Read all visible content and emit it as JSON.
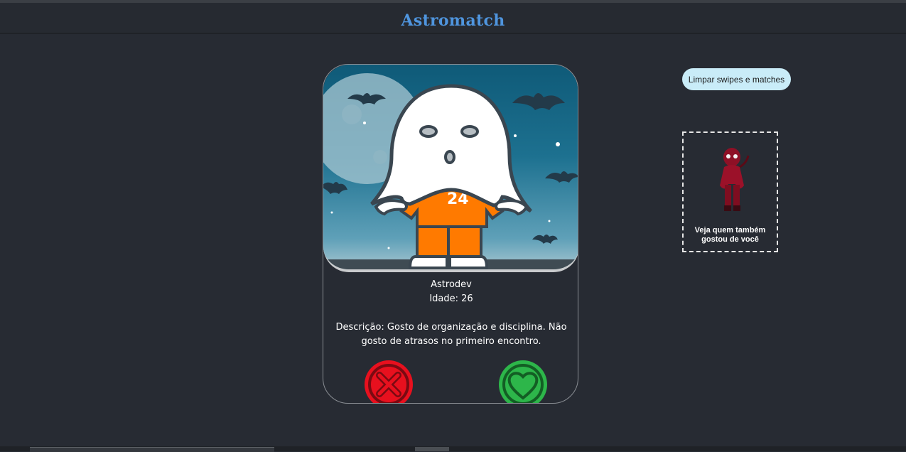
{
  "header": {
    "title": "Astromatch"
  },
  "profile": {
    "name": "Astrodev",
    "age_text": "Idade: 26",
    "description": "Descrição: Gosto de organização e disciplina. Não gosto de atrasos no primeiro encontro.",
    "shirt_number": "24"
  },
  "actions": {
    "reject_icon": "x-circle-icon",
    "like_icon": "heart-icon"
  },
  "sidebar": {
    "clear_label": "Limpar swipes e matches",
    "matches_label": "Veja quem também gostou de você"
  },
  "colors": {
    "title": "#4f95de",
    "reject": "#e8101e",
    "like": "#2db64a",
    "clear_button_bg": "#c9ecf8",
    "background": "#272b33"
  }
}
